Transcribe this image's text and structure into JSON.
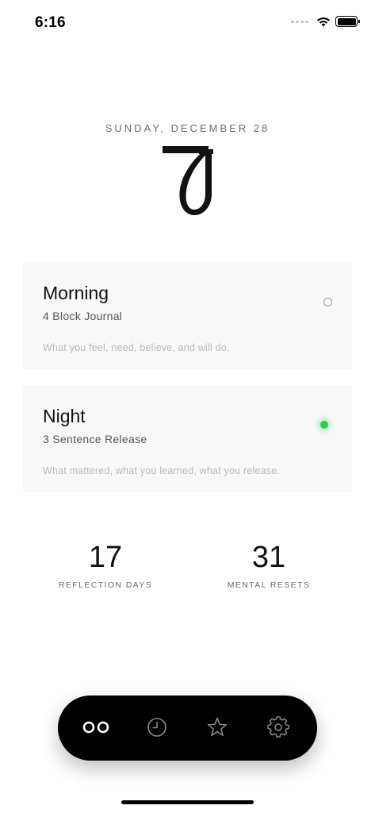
{
  "status_bar": {
    "time": "6:16"
  },
  "header": {
    "date": "SUNDAY, DECEMBER 28",
    "logo_icon": "brand-monogram-icon"
  },
  "cards": {
    "morning": {
      "title": "Morning",
      "subtitle": "4 Block Journal",
      "description": "What you feel, need, believe, and will do.",
      "status": "incomplete"
    },
    "night": {
      "title": "Night",
      "subtitle": "3 Sentence Release",
      "description": "What mattered, what you learned, what you release.",
      "status": "complete",
      "status_color": "#2ecc55"
    }
  },
  "stats": {
    "reflection_days": {
      "value": "17",
      "label": "REFLECTION DAYS"
    },
    "mental_resets": {
      "value": "31",
      "label": "MENTAL RESETS"
    }
  },
  "tab_bar": {
    "tabs": [
      {
        "name": "home",
        "icon": "double-circle-icon",
        "active": true
      },
      {
        "name": "history",
        "icon": "clock-icon",
        "active": false
      },
      {
        "name": "favorites",
        "icon": "star-icon",
        "active": false
      },
      {
        "name": "settings",
        "icon": "gear-icon",
        "active": false
      }
    ]
  }
}
